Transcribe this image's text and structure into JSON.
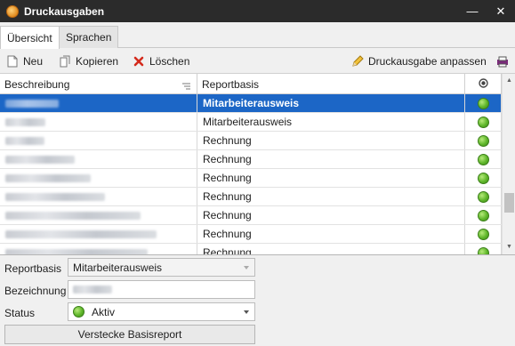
{
  "window": {
    "title": "Druckausgaben",
    "minimize": "—",
    "close": "✕"
  },
  "tabs": [
    {
      "label": "Übersicht"
    },
    {
      "label": "Sprachen"
    }
  ],
  "toolbar": {
    "new_label": "Neu",
    "copy_label": "Kopieren",
    "delete_label": "Löschen",
    "adjust_label": "Druckausgabe anpassen"
  },
  "grid": {
    "columns": {
      "description": "Beschreibung",
      "report_base": "Reportbasis"
    },
    "rows": [
      {
        "report_base": "Mitarbeiterausweis",
        "status": "green",
        "selected": true
      },
      {
        "report_base": "Mitarbeiterausweis",
        "status": "green"
      },
      {
        "report_base": "Rechnung",
        "status": "green"
      },
      {
        "report_base": "Rechnung",
        "status": "green"
      },
      {
        "report_base": "Rechnung",
        "status": "green"
      },
      {
        "report_base": "Rechnung",
        "status": "green"
      },
      {
        "report_base": "Rechnung",
        "status": "green"
      },
      {
        "report_base": "Rechnung",
        "status": "green"
      },
      {
        "report_base": "Rechnung",
        "status": "green"
      }
    ],
    "status_color": "#5fb62a",
    "selection_color": "#1c66c6"
  },
  "form": {
    "report_base_label": "Reportbasis",
    "report_base_value": "Mitarbeiterausweis",
    "name_label": "Bezeichnung",
    "status_label": "Status",
    "status_value": "Aktiv",
    "hide_button": "Verstecke Basisreport"
  }
}
